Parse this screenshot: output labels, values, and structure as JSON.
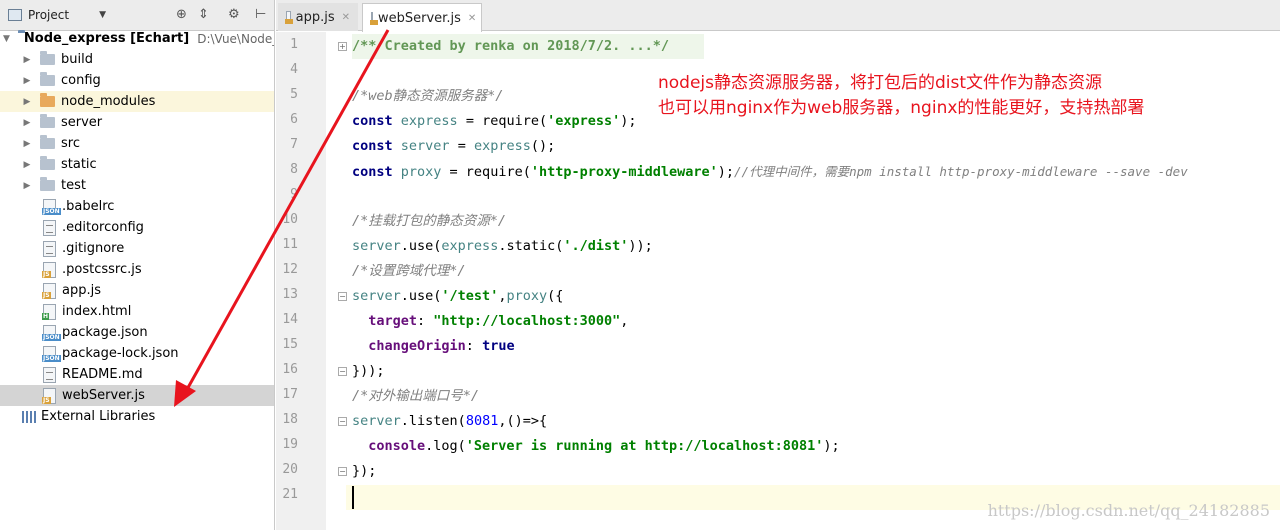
{
  "project_panel": {
    "title": "Project",
    "tools": [
      "⊕",
      "⇕",
      "⚙",
      "⊢"
    ],
    "root": {
      "name": "Node_express [Echart]",
      "path": "D:\\Vue\\Node_ex"
    },
    "items": [
      {
        "label": "build",
        "type": "folder"
      },
      {
        "label": "config",
        "type": "folder"
      },
      {
        "label": "node_modules",
        "type": "folder-orange"
      },
      {
        "label": "server",
        "type": "folder"
      },
      {
        "label": "src",
        "type": "folder"
      },
      {
        "label": "static",
        "type": "folder"
      },
      {
        "label": "test",
        "type": "folder"
      },
      {
        "label": ".babelrc",
        "type": "json"
      },
      {
        "label": ".editorconfig",
        "type": "plain"
      },
      {
        "label": ".gitignore",
        "type": "plain"
      },
      {
        "label": ".postcssrc.js",
        "type": "js"
      },
      {
        "label": "app.js",
        "type": "js"
      },
      {
        "label": "index.html",
        "type": "html"
      },
      {
        "label": "package.json",
        "type": "json"
      },
      {
        "label": "package-lock.json",
        "type": "json"
      },
      {
        "label": "README.md",
        "type": "plain"
      },
      {
        "label": "webServer.js",
        "type": "js"
      }
    ],
    "external_libraries": "External Libraries"
  },
  "tabs": [
    {
      "label": "app.js",
      "active": false
    },
    {
      "label": "webServer.js",
      "active": true
    }
  ],
  "editor": {
    "line_numbers": [
      "1",
      "4",
      "5",
      "6",
      "7",
      "8",
      "9",
      "10",
      "11",
      "12",
      "13",
      "14",
      "15",
      "16",
      "17",
      "18",
      "19",
      "20",
      "21"
    ],
    "code": {
      "l1": "/** Created by renka on 2018/7/2. ...*/",
      "l5": "/*web静态资源服务器*/",
      "l6a": "const",
      "l6b": "express",
      "l6c": " = require(",
      "l6d": "'express'",
      "l6e": ");",
      "l7a": "const",
      "l7b": "server",
      "l7c": " = ",
      "l7d": "express",
      "l7e": "();",
      "l8a": "const",
      "l8b": "proxy",
      "l8c": " = require(",
      "l8d": "'http-proxy-middleware'",
      "l8e": ");",
      "l8f": "//代理中间件，需要npm install http-proxy-middleware --save -dev",
      "l10": "/*挂载打包的静态资源*/",
      "l11a": "server",
      "l11b": ".use(",
      "l11c": "express",
      "l11d": ".static(",
      "l11e": "'./dist'",
      "l11f": "));",
      "l12": "/*设置跨域代理*/",
      "l13a": "server",
      "l13b": ".use(",
      "l13c": "'/test'",
      "l13d": ",",
      "l13e": "proxy",
      "l13f": "({",
      "l14a": "  target",
      "l14b": ": ",
      "l14c": "\"http://localhost:3000\"",
      "l14d": ",",
      "l15a": "  changeOrigin",
      "l15b": ": ",
      "l15c": "true",
      "l16": "}));",
      "l17": "/*对外输出端口号*/",
      "l18a": "server",
      "l18b": ".listen(",
      "l18c": "8081",
      "l18d": ",()=>{",
      "l19a": "  console",
      "l19b": ".log(",
      "l19c": "'Server is running at http://localhost:8081'",
      "l19d": ");",
      "l20": "});"
    }
  },
  "annotation": {
    "line1": "nodejs静态资源服务器，将打包后的dist文件作为静态资源",
    "line2": "也可以用nginx作为web服务器，nginx的性能更好，支持热部署",
    "color": "#e8141e"
  },
  "watermark": "https://blog.csdn.net/qq_24182885",
  "colors": {
    "keyword": "#000080",
    "string": "#008000",
    "comment": "#808080",
    "number": "#0000ff",
    "property": "#660e7a",
    "variable": "#458383"
  }
}
